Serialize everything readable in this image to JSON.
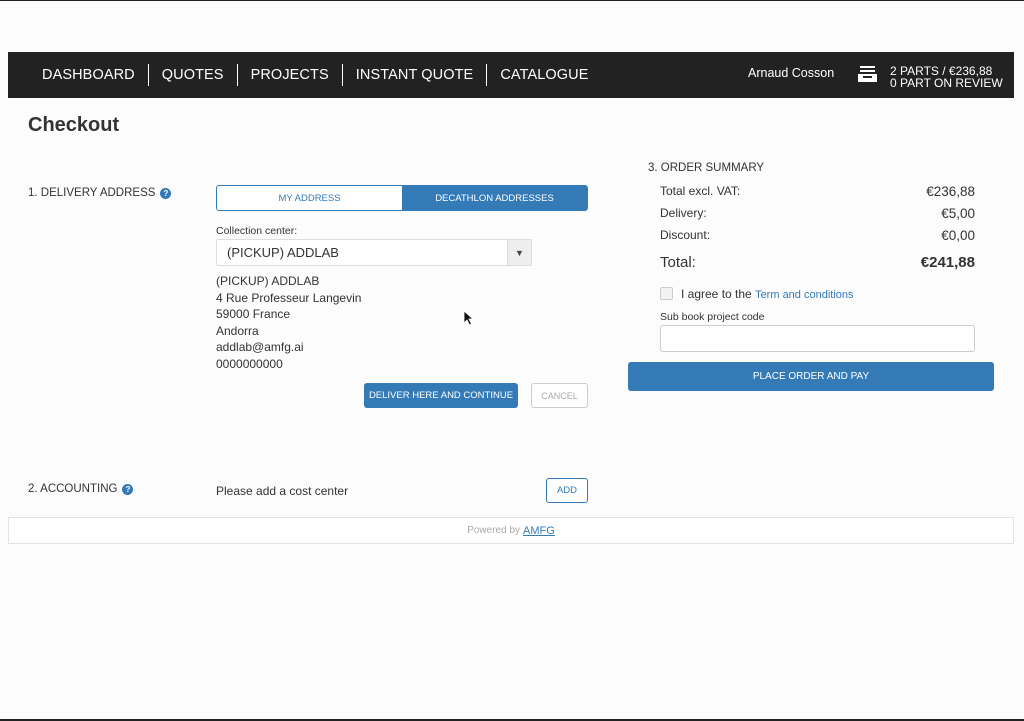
{
  "nav": {
    "links": [
      "DASHBOARD",
      "QUOTES",
      "PROJECTS",
      "INSTANT QUOTE",
      "CATALOGUE"
    ],
    "user": "Arnaud Cosson",
    "cart_line1": "2 PARTS / €236,88",
    "cart_line2": "0 PART ON REVIEW"
  },
  "page": {
    "title": "Checkout"
  },
  "delivery": {
    "label": "1. DELIVERY ADDRESS",
    "tab_my": "MY ADDRESS",
    "tab_decathlon": "DECATHLON ADDRESSES",
    "collection_label": "Collection center:",
    "collection_value": "(PICKUP) ADDLAB",
    "address_lines": [
      "(PICKUP) ADDLAB",
      "4 Rue Professeur Langevin",
      "59000 France",
      "Andorra",
      "addlab@amfg.ai",
      "0000000000"
    ],
    "deliver_button": "DELIVER HERE AND CONTINUE",
    "cancel_button": "CANCEL"
  },
  "accounting": {
    "label": "2. ACCOUNTING",
    "text": "Please add a cost center",
    "add_button": "ADD"
  },
  "summary": {
    "title": "3. ORDER SUMMARY",
    "rows": [
      {
        "label": "Total excl. VAT:",
        "value": "€236,88"
      },
      {
        "label": "Delivery:",
        "value": "€5,00"
      },
      {
        "label": "Discount:",
        "value": "€0,00"
      }
    ],
    "total_label": "Total:",
    "total_value": "€241,88",
    "agree_text": "I agree to the",
    "agree_link": "Term and conditions",
    "sub_label": "Sub book project code",
    "place_order_button": "PLACE ORDER AND PAY"
  },
  "footer": {
    "text": "Powered by",
    "link": "AMFG"
  },
  "colors": {
    "accent": "#337ab7",
    "navbar": "#222222"
  }
}
